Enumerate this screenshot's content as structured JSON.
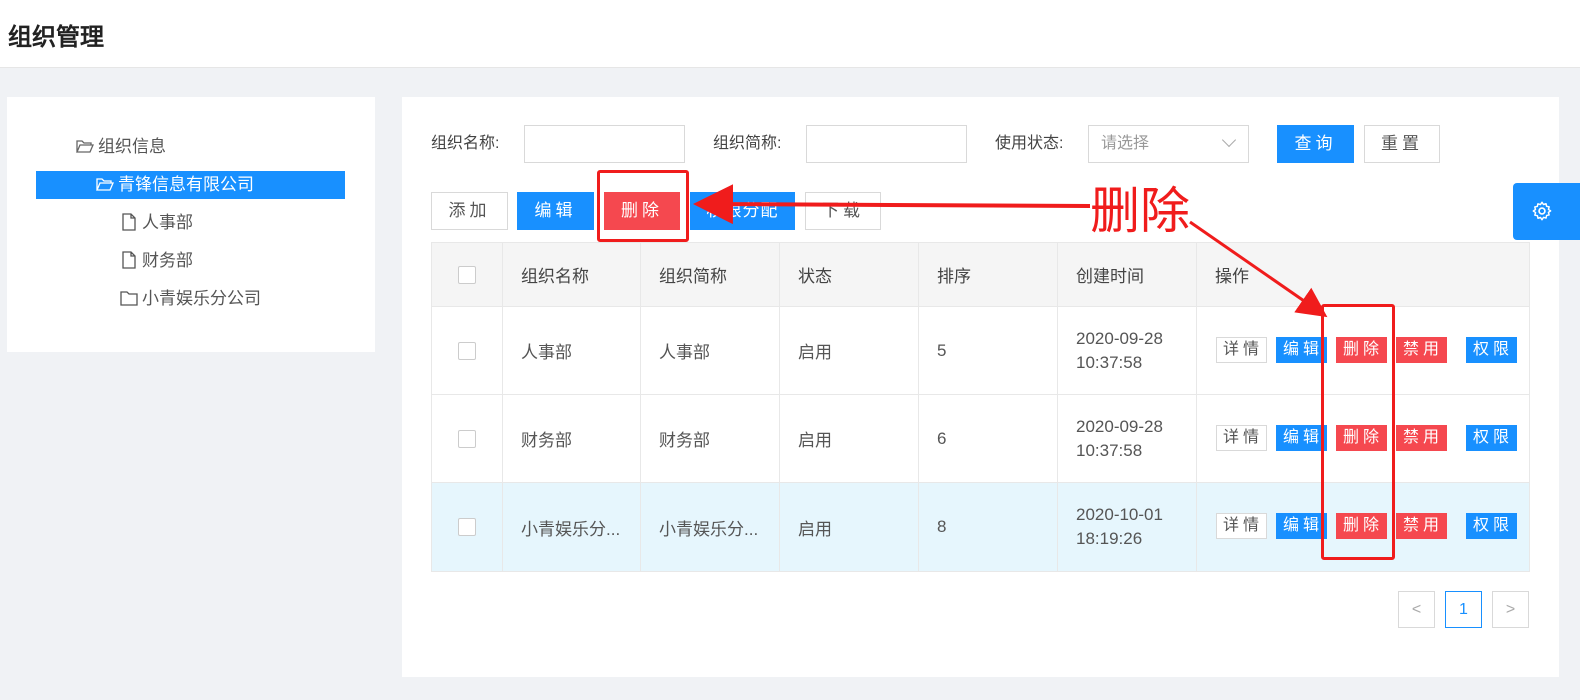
{
  "page": {
    "title": "组织管理"
  },
  "tree": {
    "root": "组织信息",
    "selected": "青锋信息有限公司",
    "children": [
      "人事部",
      "财务部",
      "小青娱乐分公司"
    ]
  },
  "filters": {
    "name_label": "组织名称:",
    "short_label": "组织简称:",
    "status_label": "使用状态:",
    "status_placeholder": "请选择",
    "search_button": "查询",
    "reset_button": "重置"
  },
  "toolbar": {
    "add": "添加",
    "edit": "编辑",
    "delete": "删除",
    "permission": "权限分配",
    "download": "下载"
  },
  "table": {
    "columns": [
      "组织名称",
      "组织简称",
      "状态",
      "排序",
      "创建时间",
      "操作"
    ],
    "rows": [
      {
        "name": "人事部",
        "short": "人事部",
        "status": "启用",
        "order": "5",
        "date": "2020-09-28",
        "time": "10:37:58"
      },
      {
        "name": "财务部",
        "short": "财务部",
        "status": "启用",
        "order": "6",
        "date": "2020-09-28",
        "time": "10:37:58"
      },
      {
        "name": "小青娱乐分...",
        "short": "小青娱乐分...",
        "status": "启用",
        "order": "8",
        "date": "2020-10-01",
        "time": "18:19:26"
      }
    ],
    "actions": {
      "detail": "详情",
      "edit": "编辑",
      "delete": "删除",
      "disable": "禁用",
      "permission": "权限"
    }
  },
  "pagination": {
    "prev": "<",
    "current": "1",
    "next": ">"
  },
  "annotation": {
    "text": "删除",
    "color": "#f01c1c"
  },
  "colors": {
    "primary": "#1890ff",
    "danger": "#f5484f",
    "highlight_row": "#e6f6fd"
  },
  "icons": {
    "folder": "folder-icon",
    "file": "file-icon",
    "settings": "gear-icon"
  }
}
